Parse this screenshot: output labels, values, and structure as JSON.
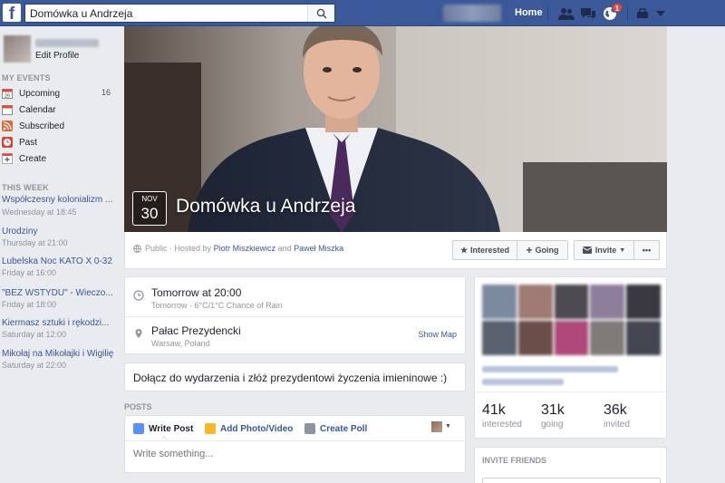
{
  "topbar": {
    "logo": "f",
    "search": {
      "value": "Domówka u Andrzeja",
      "icon": "search-icon"
    },
    "home_label": "Home",
    "notification_count": "1"
  },
  "sidebar": {
    "edit_profile": "Edit Profile",
    "my_events_title": "MY EVENTS",
    "nav": [
      {
        "label": "Upcoming",
        "count": "16",
        "icon": "calendar-date-icon"
      },
      {
        "label": "Calendar",
        "icon": "calendar-icon"
      },
      {
        "label": "Subscribed",
        "icon": "rss-icon"
      },
      {
        "label": "Past",
        "icon": "clock-icon"
      },
      {
        "label": "Create",
        "icon": "plus-icon"
      }
    ],
    "this_week_title": "THIS WEEK",
    "events": [
      {
        "title": "Współczesny kolonializm ...",
        "time": "Wednesday at 18:45"
      },
      {
        "title": "Urodziny",
        "time": "Thursday at 21:00"
      },
      {
        "title": "Lubelska Noc KATO X 0-32",
        "time": "Friday at 16:00"
      },
      {
        "title": "\"BEZ WSTYDU\" - Wieczo...",
        "time": "Friday at 18:00"
      },
      {
        "title": "Kiermasz sztuki i rękodzi...",
        "time": "Saturday at 12:00"
      },
      {
        "title": "Mikołaj na Mikołajki i Wigilię",
        "time": "Saturday at 22:00"
      }
    ]
  },
  "event": {
    "month": "NOV",
    "day": "30",
    "title": "Domówka u Andrzeja",
    "hosted_prefix": "Public · Hosted by",
    "host1": "Piotr Miszkiewicz",
    "and": "and",
    "host2": "Paweł Miszka",
    "buttons": {
      "interested": "Interested",
      "going": "Going",
      "invite": "Invite",
      "more": "•••"
    },
    "time_main": "Tomorrow at 20:00",
    "time_sub": "Tomorrow · 6°C/1°C Chance of Rain",
    "place_main": "Pałac Prezydencki",
    "place_sub": "Warsaw, Poland",
    "show_map": "Show Map",
    "description": "Dołącz do wydarzenia i złóż prezydentowi życzenia imieninowe :)"
  },
  "posts": {
    "label": "POSTS",
    "tabs": [
      "Write Post",
      "Add Photo/Video",
      "Create Poll"
    ],
    "placeholder": "Write something..."
  },
  "stats": [
    {
      "num": "41k",
      "label": "interested"
    },
    {
      "num": "31k",
      "label": "going"
    },
    {
      "num": "36k",
      "label": "invited"
    }
  ],
  "invite_friends_title": "INVITE FRIENDS",
  "colors": {
    "brand": "#3b5998",
    "link": "#365899",
    "bg": "#e9ebee"
  }
}
